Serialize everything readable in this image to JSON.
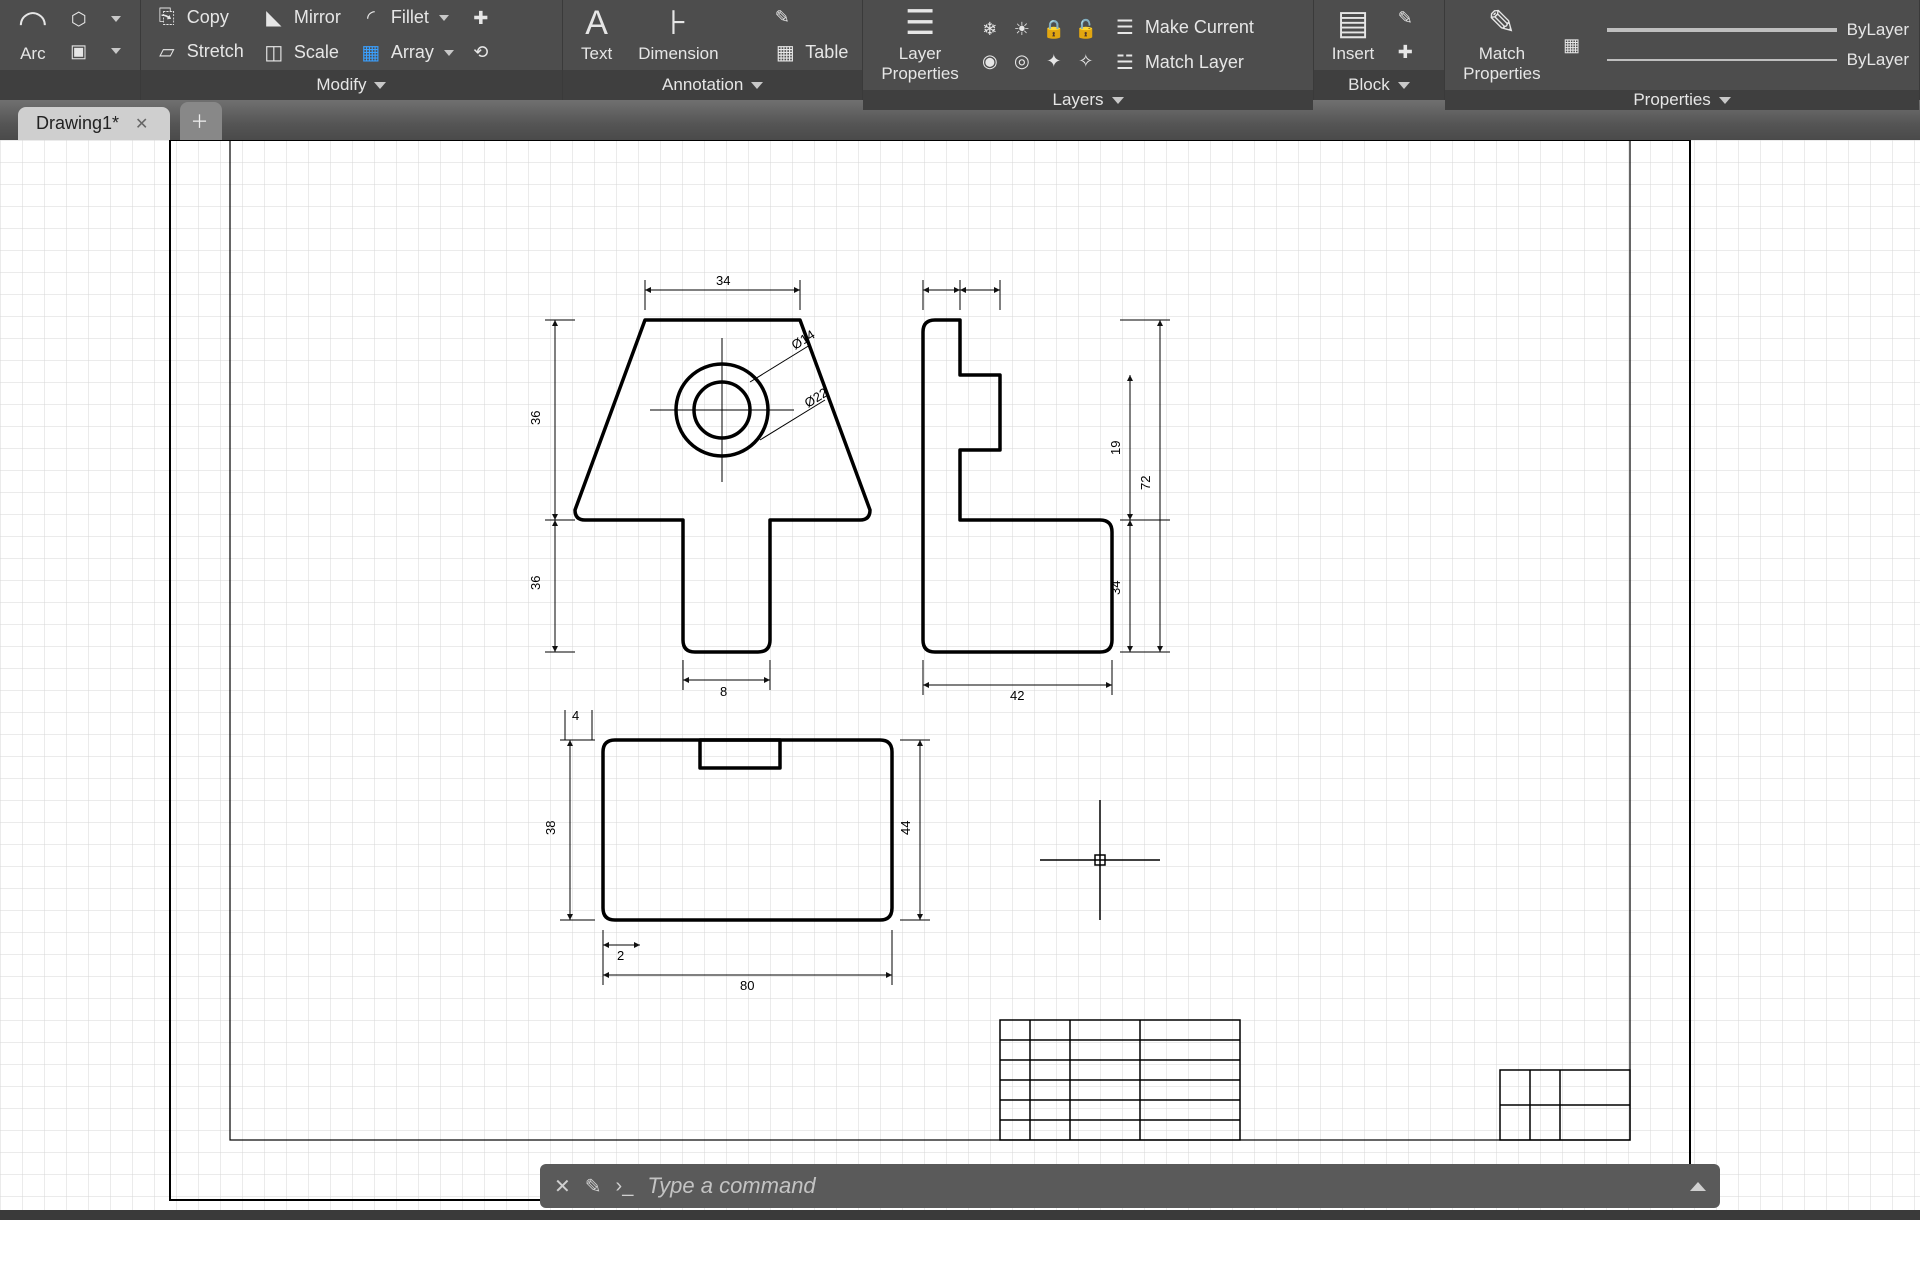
{
  "ribbon": {
    "draw": {
      "arc": "Arc"
    },
    "modify": {
      "title": "Modify",
      "copy": "Copy",
      "mirror": "Mirror",
      "fillet": "Fillet",
      "stretch": "Stretch",
      "scale": "Scale",
      "array": "Array"
    },
    "annotation": {
      "title": "Annotation",
      "text": "Text",
      "dimension": "Dimension",
      "table": "Table"
    },
    "layers": {
      "title": "Layers",
      "layer_properties": "Layer\nProperties",
      "make_current": "Make Current",
      "match_layer": "Match Layer"
    },
    "block": {
      "title": "Block",
      "insert": "Insert"
    },
    "properties": {
      "title": "Properties",
      "match": "Match\nProperties",
      "bylayer1": "ByLayer",
      "bylayer2": "ByLayer"
    }
  },
  "tabs": {
    "active": "Drawing1*"
  },
  "commandline": {
    "placeholder": "Type a command"
  },
  "drawing": {
    "dims": {
      "top_width": "34",
      "front_h1": "36",
      "front_h2": "36",
      "front_foot": "8",
      "side_h1": "19",
      "side_h2": "34",
      "side_total_h": "72",
      "side_w": "42",
      "plan_w": "80",
      "plan_h": "38",
      "plan_notch_w": "2",
      "plan_notch_h": "4",
      "inner_dia": "Ø14",
      "outer_dia": "Ø22",
      "plan_total_h": "44"
    }
  }
}
